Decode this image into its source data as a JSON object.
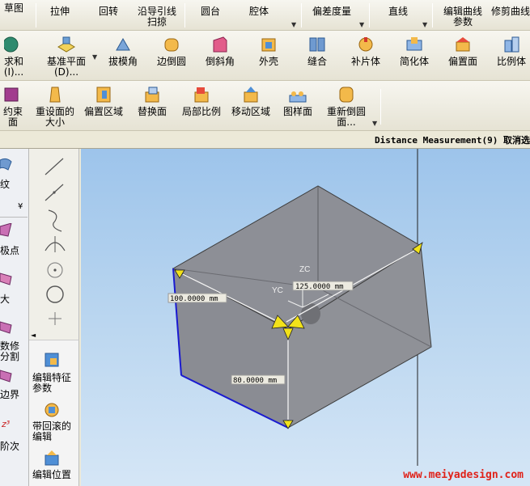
{
  "toolbar_row1": {
    "items": [
      "草图",
      "拉伸",
      "回转",
      "沿导引线扫掠",
      "圆台",
      "腔体",
      "偏差度量",
      "直线",
      "编辑曲线参数",
      "修剪曲线"
    ]
  },
  "toolbar_row2": {
    "items": [
      "求和 (I)...",
      "基准平面 (D)...",
      "拔模角",
      "边倒圆",
      "倒斜角",
      "外壳",
      "缝合",
      "补片体",
      "简化体",
      "偏置面",
      "比例体"
    ]
  },
  "toolbar_row3": {
    "items": [
      "约束面",
      "重设面的大小",
      "偏置区域",
      "替换面",
      "局部比例",
      "移动区域",
      "图样面",
      "重新倒圆面..."
    ]
  },
  "status": {
    "text": "Distance Measurement(9) 取消选"
  },
  "left_panel": {
    "items": [
      "纹",
      "极点",
      "大",
      "数修 分割",
      "边界",
      "阶次"
    ]
  },
  "edit_panel": {
    "items": [
      "编辑特征参数",
      "带回滚的编辑",
      "编辑位置"
    ]
  },
  "viewport": {
    "dimensions": [
      "100.0000 mm",
      "125.0000 mm",
      "80.0000 mm"
    ],
    "axis_labels": [
      "ZC",
      "YC"
    ],
    "watermark": "www.meiyadesign.com"
  },
  "colors": {
    "viewport_top": "#9dc4eb",
    "viewport_bottom": "#d5e6f6",
    "box_face": "#8d8f96",
    "handle_yellow": "#f2e21a",
    "edge_blue": "#1a1ad0",
    "watermark_red": "#e0221a"
  }
}
